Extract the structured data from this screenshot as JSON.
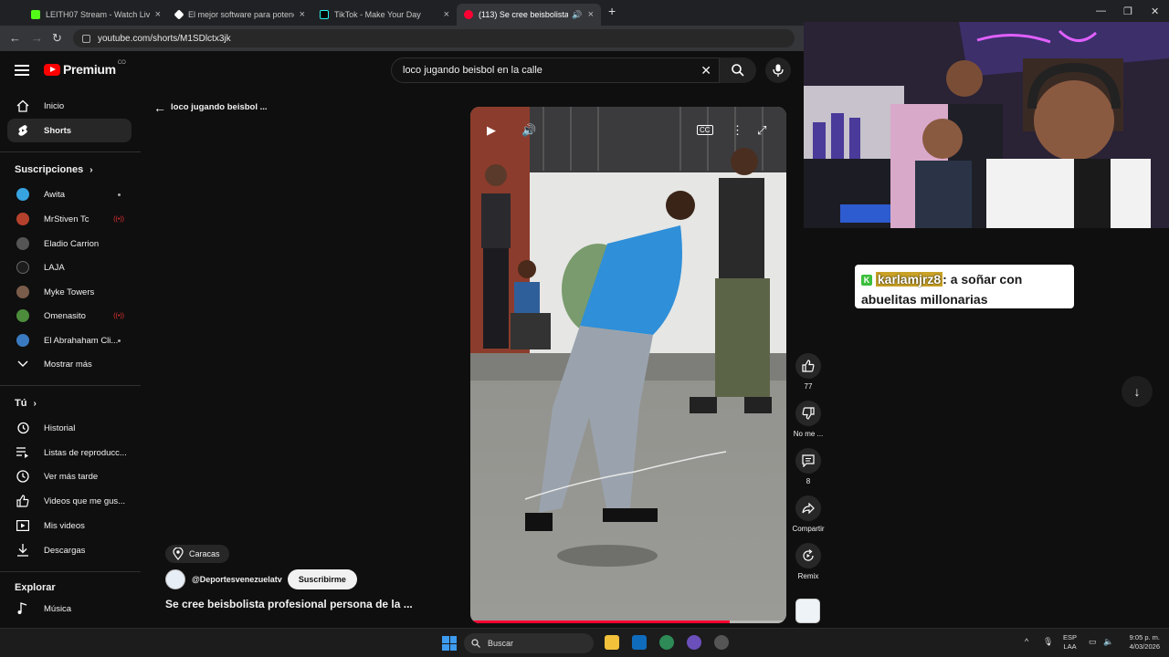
{
  "browser": {
    "tabs": [
      {
        "title": "LEITH07 Stream - Watch Live o",
        "color": "#53fc18"
      },
      {
        "title": "El mejor software para potenci",
        "color": "#ffffff"
      },
      {
        "title": "TikTok - Make Your Day",
        "color": "#000000"
      },
      {
        "title": "(113) Se cree beisbolista pr",
        "color": "#ff0033"
      }
    ],
    "url": "youtube.com/shorts/M1SDlctx3jk"
  },
  "header": {
    "logo_text": "Premium",
    "logo_superscript": "CO",
    "search_value": "loco jugando beisbol en la calle"
  },
  "sidebar": {
    "main": [
      {
        "label": "Inicio",
        "icon": "home-icon"
      },
      {
        "label": "Shorts",
        "icon": "shorts-icon"
      }
    ],
    "subscriptions_heading": "Suscripciones",
    "subscriptions": [
      {
        "label": "Awita",
        "color": "#37a3e0",
        "status": "dot"
      },
      {
        "label": "MrStiven Tc",
        "color": "#b4412c",
        "status": "live"
      },
      {
        "label": "Eladio Carrion",
        "color": "#555555",
        "status": ""
      },
      {
        "label": "LAJA",
        "color": "#1c1c1c",
        "status": ""
      },
      {
        "label": "Myke Towers",
        "color": "#7a5c4a",
        "status": ""
      },
      {
        "label": "Omenasito",
        "color": "#4c8c3c",
        "status": "live"
      },
      {
        "label": "El Abrahaham Cli...",
        "color": "#3a7ac0",
        "status": "dot"
      }
    ],
    "show_more": "Mostrar más",
    "you_heading": "Tú",
    "you_items": [
      {
        "label": "Historial",
        "icon": "history-icon"
      },
      {
        "label": "Listas de reproducc...",
        "icon": "playlists-icon"
      },
      {
        "label": "Ver más tarde",
        "icon": "watch-later-icon"
      },
      {
        "label": "Videos que me gus...",
        "icon": "liked-videos-icon"
      },
      {
        "label": "Mis videos",
        "icon": "my-videos-icon"
      },
      {
        "label": "Descargas",
        "icon": "downloads-icon"
      }
    ],
    "explore_heading": "Explorar",
    "explore_items": [
      {
        "label": "Música",
        "icon": "music-icon"
      }
    ]
  },
  "shorts": {
    "query_title": "loco jugando beisbol ...",
    "location": "Caracas",
    "channel": "@Deportesvenezuelatv",
    "subscribe_label": "Suscribirme",
    "title": "Se cree beisbolista profesional persona de la ...",
    "progress": 0.82,
    "actions": {
      "likes": "77",
      "dislike_label": "No me ...",
      "comments": "8",
      "share_label": "Compartir",
      "remix_label": "Remix"
    }
  },
  "stream_overlay": {
    "chat_user": "karlamjrz8",
    "chat_text": ": a soñar con abuelitas millonarias"
  },
  "taskbar": {
    "search_label": "Buscar",
    "lang_top": "ESP",
    "lang_bottom": "LAA",
    "time": "9:05 p. m.",
    "date": "4/03/2026"
  }
}
